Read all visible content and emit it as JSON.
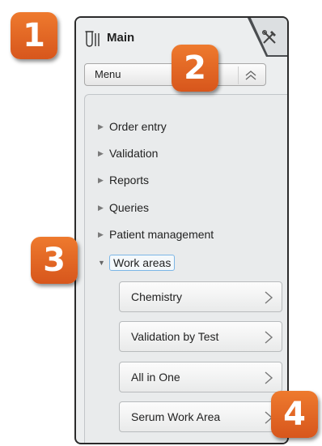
{
  "header": {
    "title": "Main"
  },
  "menu": {
    "label": "Menu"
  },
  "tree": {
    "items": [
      {
        "label": "Order entry"
      },
      {
        "label": "Validation"
      },
      {
        "label": "Reports"
      },
      {
        "label": "Queries"
      },
      {
        "label": "Patient management"
      },
      {
        "label": "Work areas"
      }
    ],
    "work_areas": [
      {
        "label": "Chemistry"
      },
      {
        "label": "Validation by Test"
      },
      {
        "label": "All in One"
      },
      {
        "label": "Serum Work Area"
      }
    ]
  },
  "callouts": [
    "1",
    "2",
    "3",
    "4"
  ],
  "colors": {
    "badge": "#e0652a",
    "panel_bg": "#eceeef",
    "selection_border": "#7cb6e6"
  },
  "icons": [
    "flask-icon",
    "tools-icon",
    "chevron-up-icon",
    "triangle-right-icon",
    "triangle-down-icon",
    "chevron-right-icon"
  ]
}
